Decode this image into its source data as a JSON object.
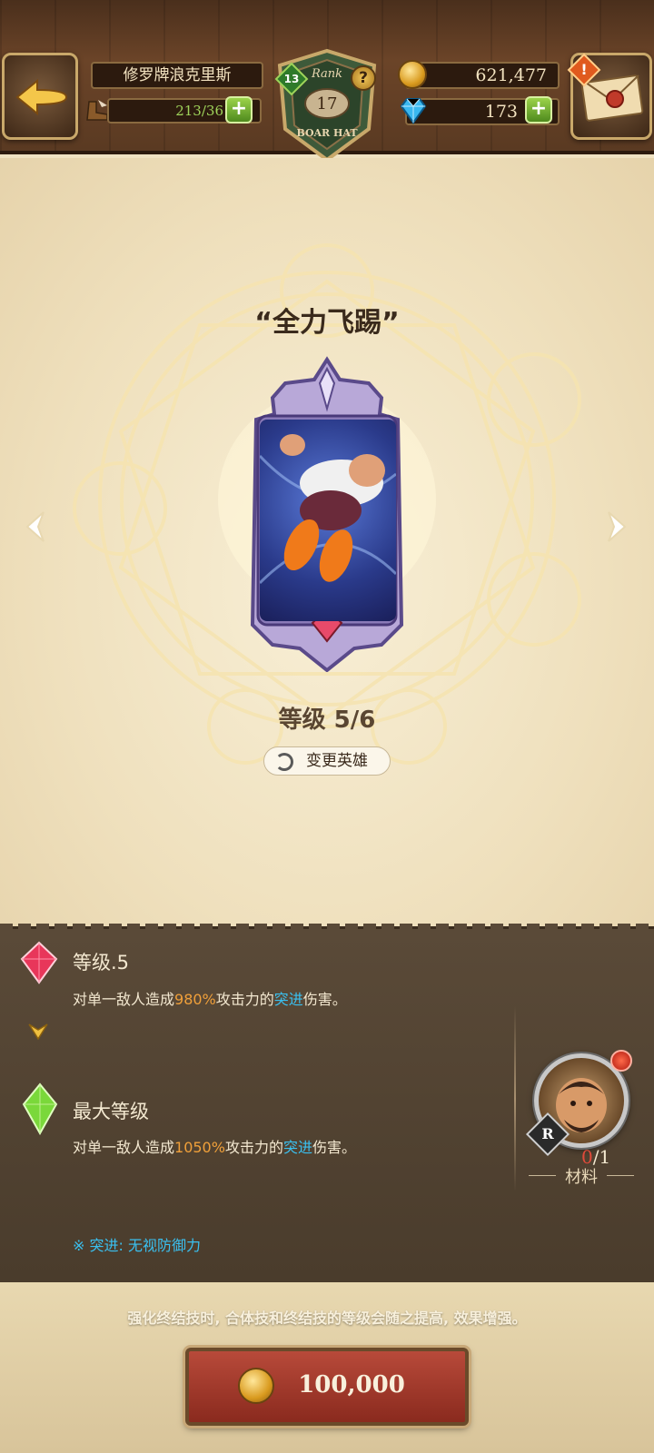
{
  "header": {
    "player_name": "修罗牌浪克里斯",
    "stamina": "213/36",
    "rank_level": "13",
    "rank_label": "Rank",
    "rank_value": "17",
    "rank_subtitle": "BOAR HAT",
    "rank_help": "?",
    "gold": "621,477",
    "gems": "173",
    "mail_alert": "!"
  },
  "skill": {
    "title": "“全力飞踢”",
    "level_text": "等级 5/6",
    "change_hero_label": "变更英雄"
  },
  "info": {
    "current_level_heading": "等级.5",
    "current_desc_prefix": "对单一敌人造成",
    "current_percent": "980%",
    "current_desc_mid": "攻击力的",
    "current_type": "突进",
    "current_desc_suffix": "伤害。",
    "max_level_heading": "最大等级",
    "max_desc_prefix": "对单一敌人造成",
    "max_percent": "1050%",
    "max_desc_mid": "攻击力的",
    "max_type": "突进",
    "max_desc_suffix": "伤害。",
    "note": "※ 突进:  无视防御力"
  },
  "material": {
    "rarity": "R",
    "count_current": "0",
    "count_total": "/1",
    "label": "材料"
  },
  "footer": {
    "info_text": "强化终结技时, 合体技和终结技的等级会随之提高, 效果增强。",
    "upgrade_cost": "100,000"
  },
  "colors": {
    "highlight_orange": "#f0a03a",
    "highlight_cyan": "#3ac0f0",
    "panel_dark": "#5a4a38",
    "button_red": "#b84a3a"
  },
  "icons": [
    "back-arrow-icon",
    "boot-icon",
    "plus-icon",
    "gold-coin-icon",
    "gem-icon",
    "mail-icon",
    "help-icon",
    "swap-icon",
    "red-gem-icon",
    "green-gem-icon",
    "chevron-icon"
  ]
}
